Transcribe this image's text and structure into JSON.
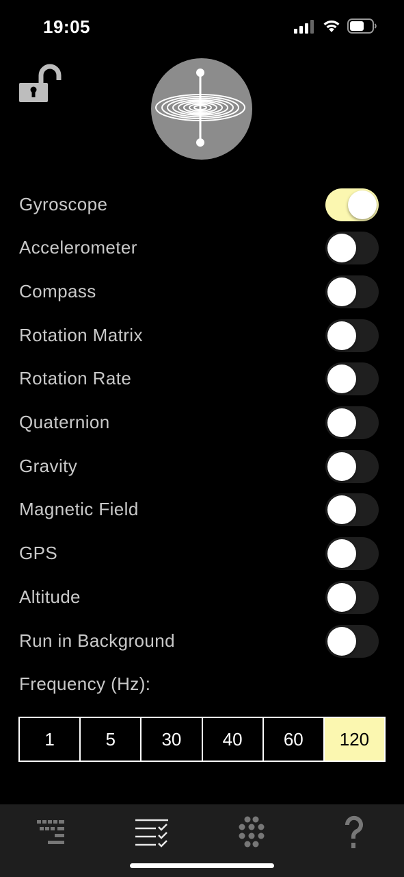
{
  "status_bar": {
    "time": "19:05",
    "icons": [
      "signal-icon",
      "wifi-icon",
      "battery-icon"
    ]
  },
  "header": {
    "lock_icon": "unlocked-padlock-icon",
    "logo_icon": "gyroscope-logo-icon"
  },
  "sensors": [
    {
      "label": "Gyroscope",
      "enabled": true
    },
    {
      "label": "Accelerometer",
      "enabled": false
    },
    {
      "label": "Compass",
      "enabled": false
    },
    {
      "label": "Rotation Matrix",
      "enabled": false
    },
    {
      "label": "Rotation Rate",
      "enabled": false
    },
    {
      "label": "Quaternion",
      "enabled": false
    },
    {
      "label": "Gravity",
      "enabled": false
    },
    {
      "label": "Magnetic Field",
      "enabled": false
    },
    {
      "label": "GPS",
      "enabled": false
    },
    {
      "label": "Altitude",
      "enabled": false
    },
    {
      "label": "Run in Background",
      "enabled": false
    }
  ],
  "frequency": {
    "label": "Frequency (Hz):",
    "options": [
      "1",
      "5",
      "30",
      "40",
      "60",
      "120"
    ],
    "selected": "120"
  },
  "tab_bar": {
    "tabs": [
      {
        "icon": "stream-lines-icon",
        "active": false
      },
      {
        "icon": "checklist-icon",
        "active": true
      },
      {
        "icon": "dot-grid-icon",
        "active": false
      },
      {
        "icon": "question-mark-icon",
        "active": false
      }
    ]
  },
  "colors": {
    "accent": "#fbf7b0",
    "background": "#000000",
    "tab_bar": "#1e1e1e",
    "text": "#c9c9c9"
  }
}
